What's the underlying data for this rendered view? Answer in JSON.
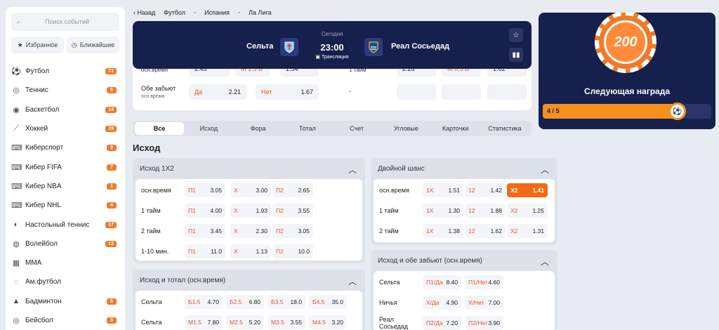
{
  "sidebar": {
    "search_placeholder": "Поиск событий",
    "favorites": "Избранное",
    "upcoming": "Ближайшие",
    "sports": [
      {
        "name": "Футбол",
        "count": "71",
        "icon": "⚽"
      },
      {
        "name": "Теннис",
        "count": "5",
        "icon": "◎"
      },
      {
        "name": "Баскетбол",
        "count": "14",
        "icon": "◉"
      },
      {
        "name": "Хоккей",
        "count": "19",
        "icon": "⟋"
      },
      {
        "name": "Киберспорт",
        "count": "9",
        "icon": "⌨"
      },
      {
        "name": "Кибер FIFA",
        "count": "7",
        "icon": "⌨"
      },
      {
        "name": "Кибер NBA",
        "count": "1",
        "icon": "⌨"
      },
      {
        "name": "Кибер NHL",
        "count": "4",
        "icon": "⌨"
      },
      {
        "name": "Настольный теннис",
        "count": "17",
        "icon": "◐"
      },
      {
        "name": "Волейбол",
        "count": "12",
        "icon": "◍"
      },
      {
        "name": "MMA",
        "count": "",
        "icon": "▦"
      },
      {
        "name": "Ам.футбол",
        "count": "",
        "icon": "◌"
      },
      {
        "name": "Бадминтон",
        "count": "5",
        "icon": "▲"
      },
      {
        "name": "Бейсбол",
        "count": "3",
        "icon": "◎"
      }
    ]
  },
  "breadcrumb": {
    "back": "Назад",
    "items": [
      "Футбол",
      "Испания",
      "Ла Лига"
    ]
  },
  "match": {
    "home": "Сельта",
    "away": "Реал Сосьедад",
    "date": "Сегодня",
    "time": "23:00",
    "broadcast": "Трансляция",
    "home_color": "#3a4a8a",
    "away_color": "#2a3a7a"
  },
  "hidden_rows": {
    "row1_label": "осн.время",
    "row1_val_a": "2.43",
    "row1_total": "М 1.5 Б",
    "row1_val_b": "1.54",
    "row1_right_label": "1 тайм",
    "row1_right_a": "2.26",
    "row1_right_total": "М 0.5 Б",
    "row1_right_b": "1.62",
    "row2_label": "Обе забьют",
    "row2_sub": "осн.время",
    "yes": "Да",
    "yes_val": "2.21",
    "no": "Нет",
    "no_val": "1.67",
    "dash": "-"
  },
  "tabs": [
    "Все",
    "Исход",
    "Фора",
    "Тотал",
    "Счет",
    "Угловые",
    "Карточки",
    "Статистика"
  ],
  "section_title": "Исход",
  "outcome_1x2": {
    "title": "Исход 1X2",
    "rows": [
      {
        "label": "осн.время",
        "cells": [
          [
            "П1",
            "3.05"
          ],
          [
            "X",
            "3.00"
          ],
          [
            "П2",
            "2.65"
          ]
        ]
      },
      {
        "label": "1 тайм",
        "cells": [
          [
            "П1",
            "4.00"
          ],
          [
            "X",
            "1.93"
          ],
          [
            "П2",
            "3.55"
          ]
        ]
      },
      {
        "label": "2 тайм",
        "cells": [
          [
            "П1",
            "3.45"
          ],
          [
            "X",
            "2.30"
          ],
          [
            "П2",
            "3.05"
          ]
        ]
      },
      {
        "label": "1-10 мин.",
        "cells": [
          [
            "П1",
            "11.0"
          ],
          [
            "X",
            "1.13"
          ],
          [
            "П2",
            "10.0"
          ]
        ]
      }
    ]
  },
  "double_chance": {
    "title": "Двойной шанс",
    "rows": [
      {
        "label": "осн.время",
        "cells": [
          [
            "1X",
            "1.51"
          ],
          [
            "12",
            "1.42"
          ],
          [
            "X2",
            "1.41"
          ]
        ]
      },
      {
        "label": "1 тайм",
        "cells": [
          [
            "1X",
            "1.30"
          ],
          [
            "12",
            "1.88"
          ],
          [
            "X2",
            "1.25"
          ]
        ]
      },
      {
        "label": "2 тайм",
        "cells": [
          [
            "1X",
            "1.38"
          ],
          [
            "12",
            "1.62"
          ],
          [
            "X2",
            "1.31"
          ]
        ]
      }
    ]
  },
  "outcome_total": {
    "title": "Исход и тотал (осн.время)",
    "rows": [
      {
        "label": "Сельта",
        "cells": [
          [
            "Б1.5",
            "4.70"
          ],
          [
            "Б2.5",
            "6.80"
          ],
          [
            "Б3.5",
            "18.0"
          ],
          [
            "Б4.5",
            "35.0"
          ]
        ]
      },
      {
        "label": "Сельта",
        "cells": [
          [
            "М1.5",
            "7.80"
          ],
          [
            "М2.5",
            "5.20"
          ],
          [
            "М3.5",
            "3.55"
          ],
          [
            "М4.5",
            "3.20"
          ]
        ]
      }
    ]
  },
  "outcome_both": {
    "title": "Исход и обе забьют (осн.время)",
    "rows": [
      {
        "label": "Сельта",
        "cells": [
          [
            "П1/Да",
            "8.40"
          ],
          [
            "П1/Нет",
            "4.60"
          ]
        ]
      },
      {
        "label": "Ничья",
        "cells": [
          [
            "Х/Да",
            "4.90"
          ],
          [
            "Х/Нет",
            "7.00"
          ]
        ]
      },
      {
        "label": "Реал Сосьедад",
        "cells": [
          [
            "П2/Да",
            "7.20"
          ],
          [
            "П2/Нет",
            "3.90"
          ]
        ]
      }
    ]
  },
  "promo": {
    "chip_value": "200",
    "reward_title": "Следующая награда",
    "progress_text": "4 / 5",
    "progress_fraction": 0.8
  },
  "colors": {
    "accent": "#f36a12",
    "header_bg": "#16204d",
    "odds_label": "#e0562f"
  }
}
